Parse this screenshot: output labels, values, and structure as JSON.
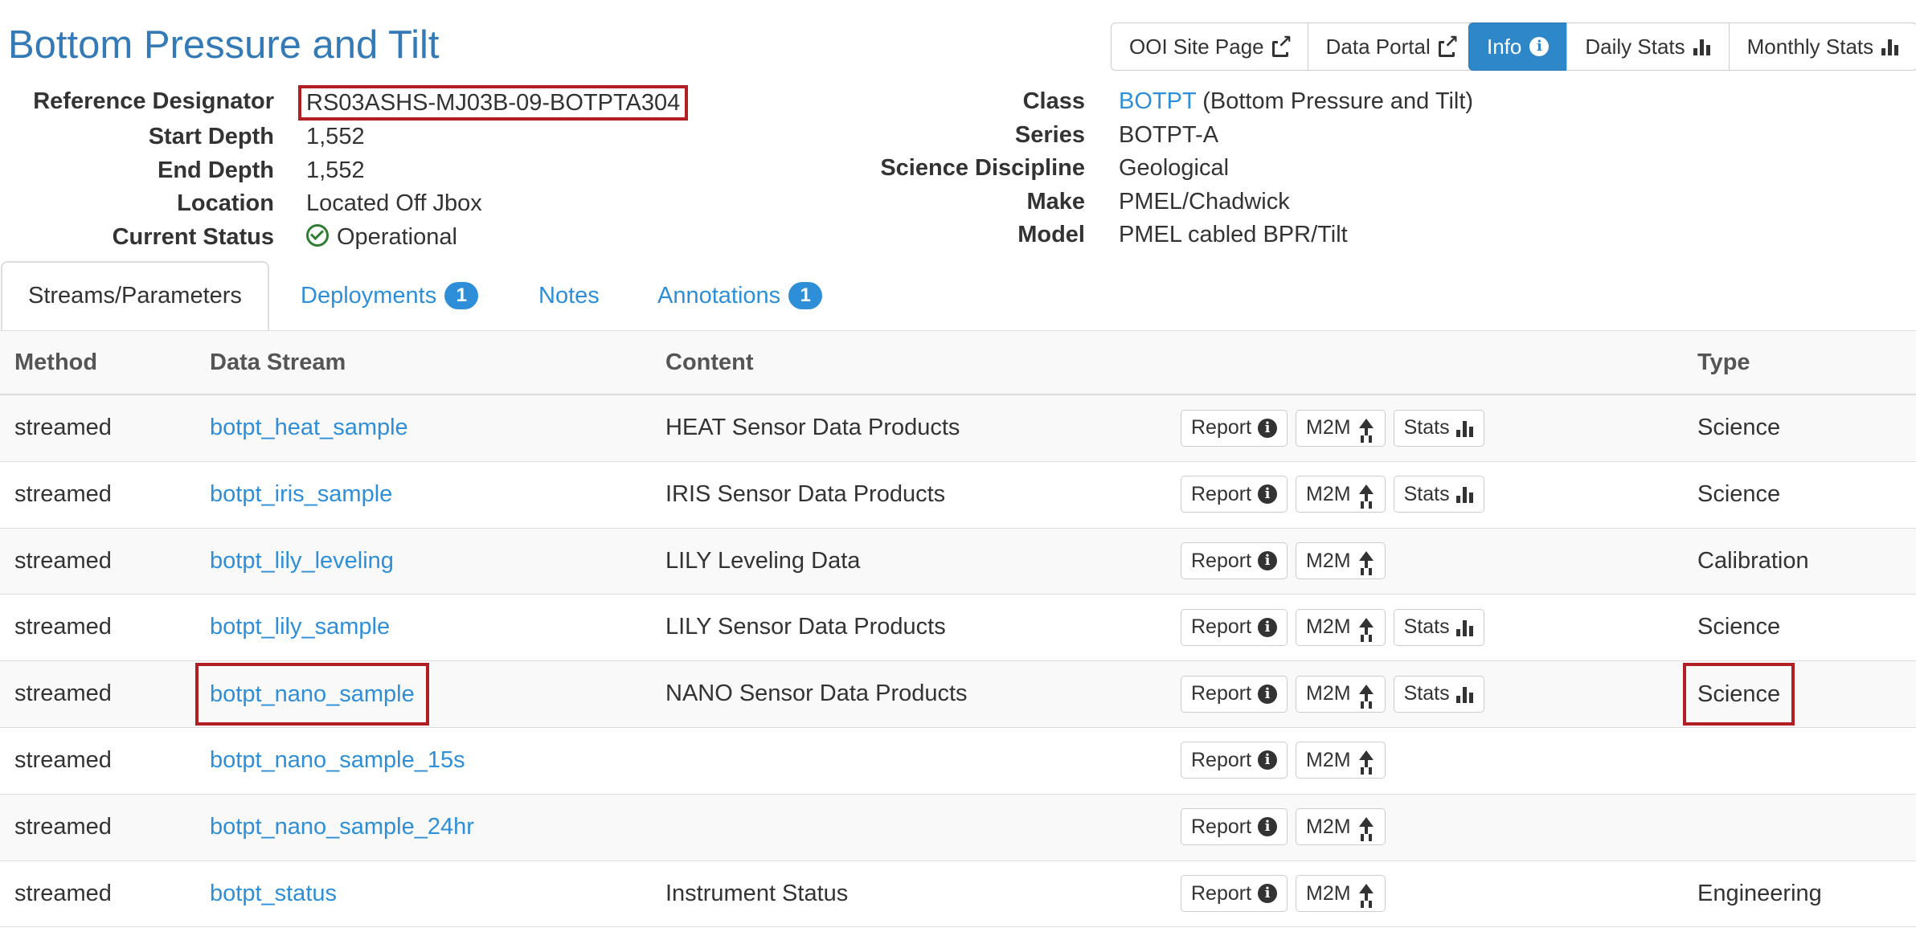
{
  "title": "Bottom Pressure and Tilt",
  "header_buttons": [
    {
      "label": "OOI Site Page",
      "icon": "external-link-icon"
    },
    {
      "label": "Data Portal",
      "icon": "external-link-icon"
    },
    {
      "label": "Info",
      "icon": "info-icon",
      "active": true
    },
    {
      "label": "Daily Stats",
      "icon": "bar-chart-icon"
    },
    {
      "label": "Monthly Stats",
      "icon": "bar-chart-icon"
    }
  ],
  "info_left": [
    {
      "label": "Reference Designator",
      "value": "RS03ASHS-MJ03B-09-BOTPTA304",
      "highlighted": true
    },
    {
      "label": "Start Depth",
      "value": "1,552"
    },
    {
      "label": "End Depth",
      "value": "1,552"
    },
    {
      "label": "Location",
      "value": "Located Off Jbox"
    },
    {
      "label": "Current Status",
      "value": "Operational",
      "icon": "check-circle-icon"
    }
  ],
  "info_right": [
    {
      "label": "Class",
      "link": "BOTPT",
      "value": "(Bottom Pressure and Tilt)"
    },
    {
      "label": "Series",
      "link": "BOTPT-A",
      "value": ""
    },
    {
      "label": "Science Discipline",
      "value": "Geological"
    },
    {
      "label": "Make",
      "value": "PMEL/Chadwick"
    },
    {
      "label": "Model",
      "value": "PMEL cabled BPR/Tilt"
    }
  ],
  "tabs": [
    {
      "label": "Streams/Parameters",
      "active": true,
      "badge": ""
    },
    {
      "label": "Deployments",
      "badge": "1"
    },
    {
      "label": "Notes",
      "badge": ""
    },
    {
      "label": "Annotations",
      "badge": "1"
    }
  ],
  "table": {
    "headers": {
      "method": "Method",
      "stream": "Data Stream",
      "content": "Content",
      "type": "Type"
    },
    "action_labels": {
      "report": "Report",
      "m2m": "M2M",
      "stats": "Stats"
    },
    "rows": [
      {
        "method": "streamed",
        "stream": "botpt_heat_sample",
        "content": "HEAT Sensor Data Products",
        "stats": true,
        "type": "Science"
      },
      {
        "method": "streamed",
        "stream": "botpt_iris_sample",
        "content": "IRIS Sensor Data Products",
        "stats": true,
        "type": "Science"
      },
      {
        "method": "streamed",
        "stream": "botpt_lily_leveling",
        "content": "LILY Leveling Data",
        "stats": false,
        "type": "Calibration"
      },
      {
        "method": "streamed",
        "stream": "botpt_lily_sample",
        "content": "LILY Sensor Data Products",
        "stats": true,
        "type": "Science"
      },
      {
        "method": "streamed",
        "stream": "botpt_nano_sample",
        "content": "NANO Sensor Data Products",
        "stats": true,
        "type": "Science",
        "highlighted": true
      },
      {
        "method": "streamed",
        "stream": "botpt_nano_sample_15s",
        "content": "",
        "stats": false,
        "type": ""
      },
      {
        "method": "streamed",
        "stream": "botpt_nano_sample_24hr",
        "content": "",
        "stats": false,
        "type": ""
      },
      {
        "method": "streamed",
        "stream": "botpt_status",
        "content": "Instrument Status",
        "stats": false,
        "type": "Engineering"
      }
    ]
  },
  "colors": {
    "link": "#2e8fd8",
    "title": "#337ab7",
    "highlight_box": "#b11f24",
    "status_ok": "#2e7d32",
    "active_button": "#2e87c9"
  }
}
